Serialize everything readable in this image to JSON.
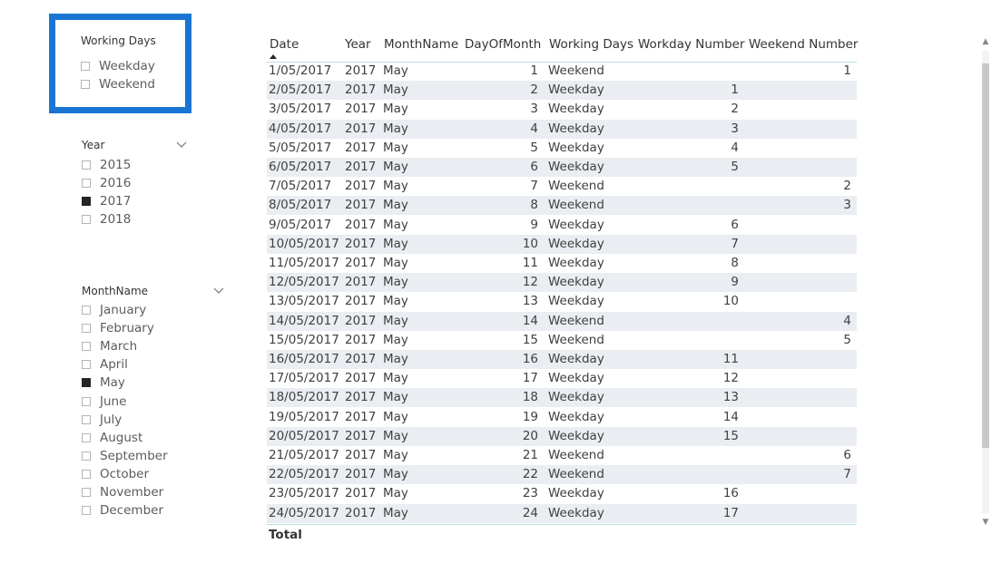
{
  "working_days_slicer": {
    "title": "Working Days",
    "items": [
      {
        "label": "Weekday",
        "checked": false
      },
      {
        "label": "Weekend",
        "checked": false
      }
    ]
  },
  "year_slicer": {
    "title": "Year",
    "items": [
      {
        "label": "2015",
        "checked": false
      },
      {
        "label": "2016",
        "checked": false
      },
      {
        "label": "2017",
        "checked": true
      },
      {
        "label": "2018",
        "checked": false
      }
    ]
  },
  "month_slicer": {
    "title": "MonthName",
    "items": [
      {
        "label": "January",
        "checked": false
      },
      {
        "label": "February",
        "checked": false
      },
      {
        "label": "March",
        "checked": false
      },
      {
        "label": "April",
        "checked": false
      },
      {
        "label": "May",
        "checked": true
      },
      {
        "label": "June",
        "checked": false
      },
      {
        "label": "July",
        "checked": false
      },
      {
        "label": "August",
        "checked": false
      },
      {
        "label": "September",
        "checked": false
      },
      {
        "label": "October",
        "checked": false
      },
      {
        "label": "November",
        "checked": false
      },
      {
        "label": "December",
        "checked": false
      }
    ]
  },
  "table": {
    "columns": [
      "Date",
      "Year",
      "MonthName",
      "DayOfMonth",
      "Working Days",
      "Workday Number",
      "Weekend Number"
    ],
    "sorted_column": "Date",
    "rows": [
      [
        "1/05/2017",
        "2017",
        "May",
        "1",
        "Weekend",
        "",
        "1"
      ],
      [
        "2/05/2017",
        "2017",
        "May",
        "2",
        "Weekday",
        "1",
        ""
      ],
      [
        "3/05/2017",
        "2017",
        "May",
        "3",
        "Weekday",
        "2",
        ""
      ],
      [
        "4/05/2017",
        "2017",
        "May",
        "4",
        "Weekday",
        "3",
        ""
      ],
      [
        "5/05/2017",
        "2017",
        "May",
        "5",
        "Weekday",
        "4",
        ""
      ],
      [
        "6/05/2017",
        "2017",
        "May",
        "6",
        "Weekday",
        "5",
        ""
      ],
      [
        "7/05/2017",
        "2017",
        "May",
        "7",
        "Weekend",
        "",
        "2"
      ],
      [
        "8/05/2017",
        "2017",
        "May",
        "8",
        "Weekend",
        "",
        "3"
      ],
      [
        "9/05/2017",
        "2017",
        "May",
        "9",
        "Weekday",
        "6",
        ""
      ],
      [
        "10/05/2017",
        "2017",
        "May",
        "10",
        "Weekday",
        "7",
        ""
      ],
      [
        "11/05/2017",
        "2017",
        "May",
        "11",
        "Weekday",
        "8",
        ""
      ],
      [
        "12/05/2017",
        "2017",
        "May",
        "12",
        "Weekday",
        "9",
        ""
      ],
      [
        "13/05/2017",
        "2017",
        "May",
        "13",
        "Weekday",
        "10",
        ""
      ],
      [
        "14/05/2017",
        "2017",
        "May",
        "14",
        "Weekend",
        "",
        "4"
      ],
      [
        "15/05/2017",
        "2017",
        "May",
        "15",
        "Weekend",
        "",
        "5"
      ],
      [
        "16/05/2017",
        "2017",
        "May",
        "16",
        "Weekday",
        "11",
        ""
      ],
      [
        "17/05/2017",
        "2017",
        "May",
        "17",
        "Weekday",
        "12",
        ""
      ],
      [
        "18/05/2017",
        "2017",
        "May",
        "18",
        "Weekday",
        "13",
        ""
      ],
      [
        "19/05/2017",
        "2017",
        "May",
        "19",
        "Weekday",
        "14",
        ""
      ],
      [
        "20/05/2017",
        "2017",
        "May",
        "20",
        "Weekday",
        "15",
        ""
      ],
      [
        "21/05/2017",
        "2017",
        "May",
        "21",
        "Weekend",
        "",
        "6"
      ],
      [
        "22/05/2017",
        "2017",
        "May",
        "22",
        "Weekend",
        "",
        "7"
      ],
      [
        "23/05/2017",
        "2017",
        "May",
        "23",
        "Weekday",
        "16",
        ""
      ],
      [
        "24/05/2017",
        "2017",
        "May",
        "24",
        "Weekday",
        "17",
        ""
      ]
    ],
    "total_label": "Total"
  },
  "colors": {
    "focus_border": "#1a75d2",
    "row_alt": "#eaedf2",
    "header_rule": "#b9dfe8",
    "checked_box": "#252423"
  },
  "icons": {
    "slicer_dropdown": "chevron-down-icon",
    "sort_indicator": "sort-ascending-icon",
    "scroll_up": "scroll-up-icon",
    "scroll_down": "scroll-down-icon"
  }
}
